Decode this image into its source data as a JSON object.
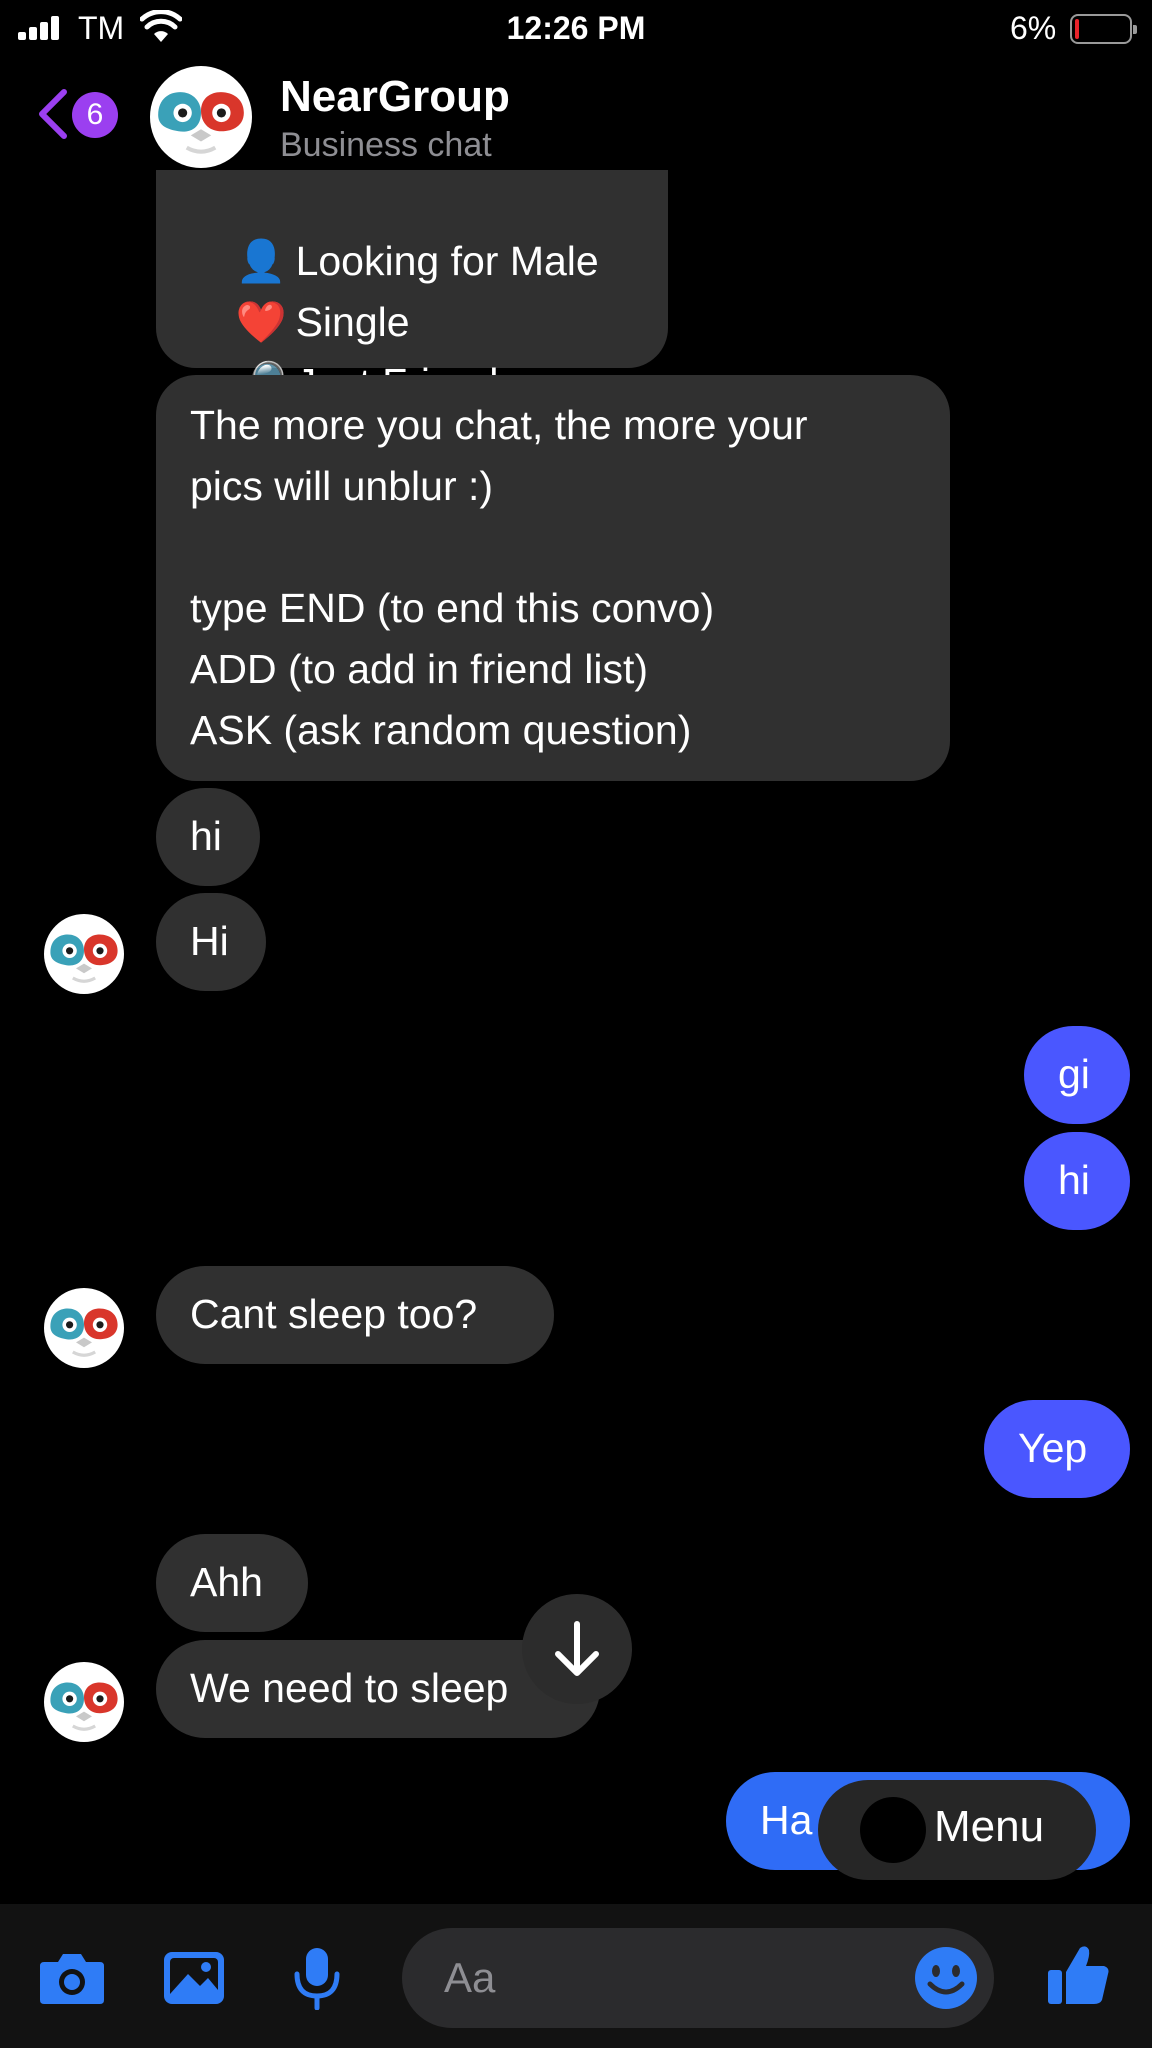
{
  "status_bar": {
    "carrier": "TM",
    "time": "12:26 PM",
    "battery_percent": "6%",
    "battery_level": 0.06
  },
  "header": {
    "back_badge": "6",
    "title": "NearGroup",
    "subtitle": "Business chat"
  },
  "messages": {
    "profile": [
      {
        "emoji": "👤",
        "text": "Looking for Male"
      },
      {
        "emoji": "❤️",
        "text": "Single"
      },
      {
        "emoji": "🔎",
        "text": "Just Friends"
      }
    ],
    "intro_lines": [
      "The more you chat, the more your",
      "pics will unblur :)",
      "",
      "type END (to end this convo)",
      "ADD (to add in friend list)",
      "ASK (ask random question)"
    ],
    "hi_lower": "hi",
    "hi_upper": "Hi",
    "out_gi": "gi",
    "out_hi": "hi",
    "cant_sleep": "Cant sleep too?",
    "out_yep": "Yep",
    "ahh": "Ahh",
    "need_sleep": "We need to sleep",
    "out_last": "Ha"
  },
  "overlays": {
    "menu_label": "Menu"
  },
  "composer": {
    "placeholder": "Aa"
  },
  "colors": {
    "incoming_bubble": "#303030",
    "outgoing_bubble": "#4a57ff",
    "accent_blue": "#2f7cf6",
    "back_purple": "#9b3ff0"
  },
  "icons": {
    "back": "chevron-left-icon",
    "camera": "camera-icon",
    "gallery": "image-icon",
    "voice": "microphone-icon",
    "emoji": "smiley-icon",
    "like": "thumbs-up-icon",
    "scroll": "arrow-down-icon"
  }
}
